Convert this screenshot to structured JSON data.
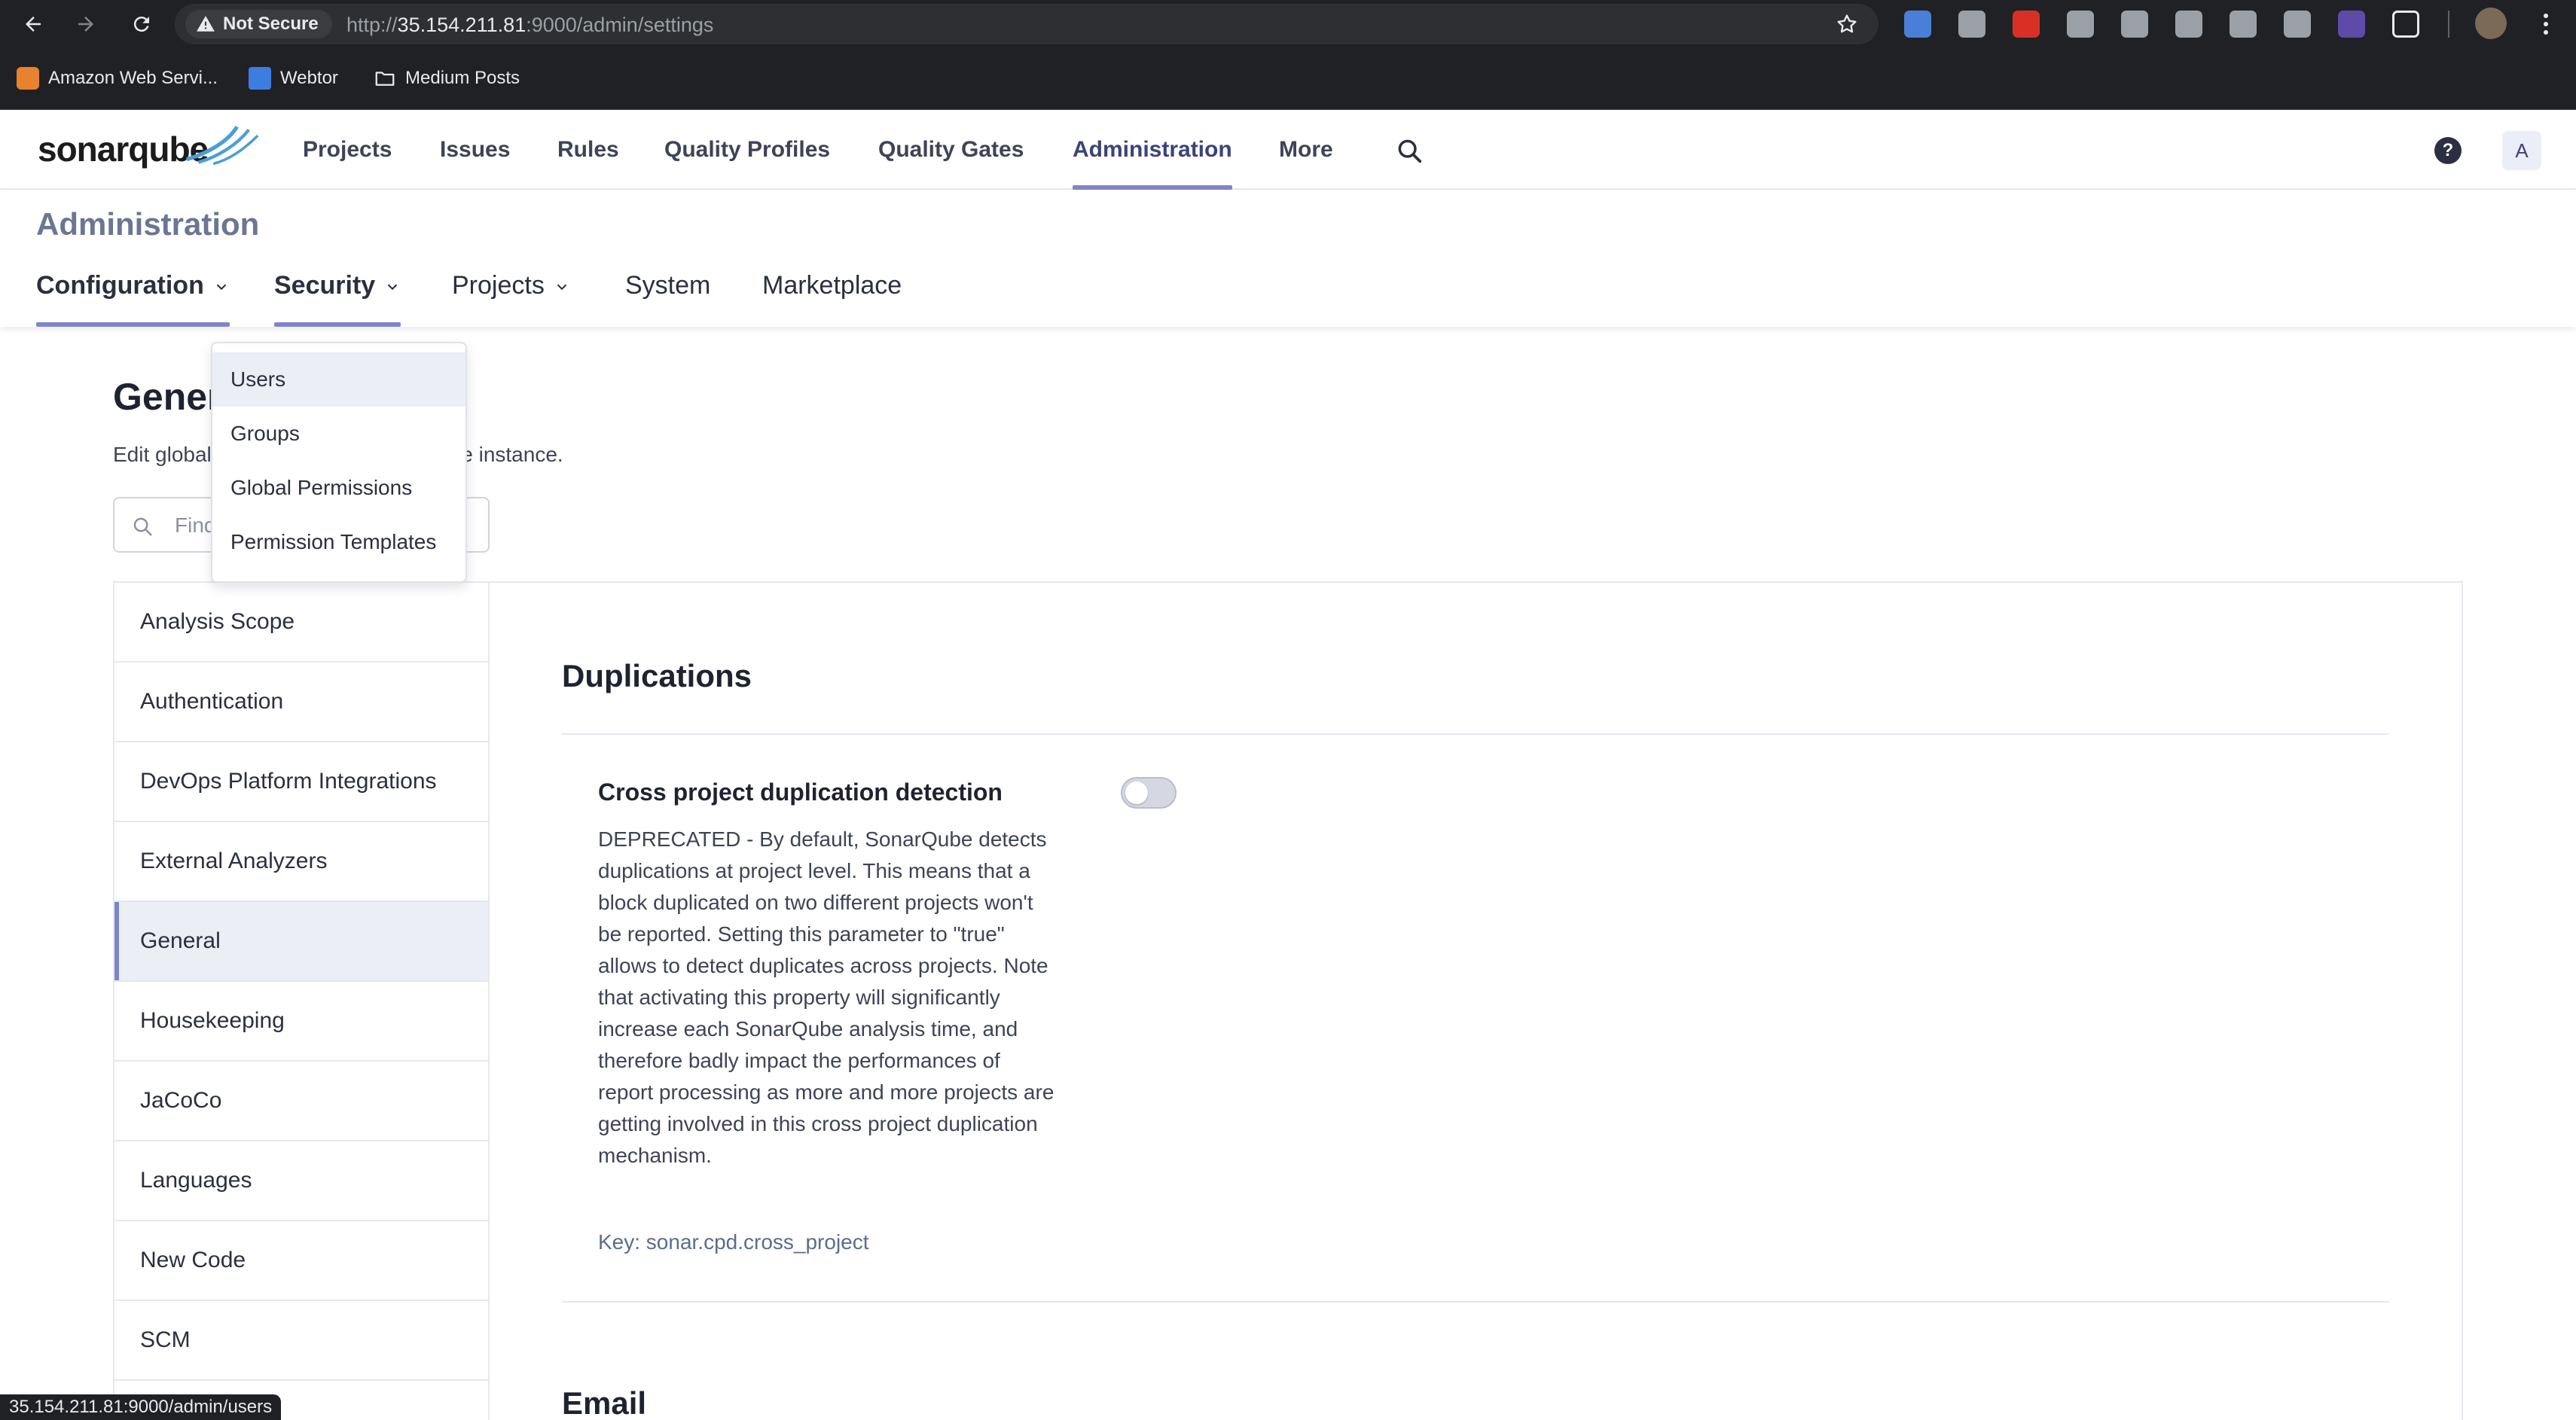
{
  "browser": {
    "security_label": "Not Secure",
    "url_prefix": "http://",
    "url_host": "35.154.211.81",
    "url_rest": ":9000/admin/settings",
    "bookmarks": [
      {
        "label": "Amazon Web Servi..."
      },
      {
        "label": "Webtor"
      },
      {
        "label": "Medium Posts"
      }
    ],
    "extension_colors": [
      "#4a7fd8",
      "#9aa0a6",
      "#d93025",
      "#9aa0a6",
      "#9aa0a6",
      "#9aa0a6",
      "#9aa0a6",
      "#9aa0a6",
      "#5e4aa8"
    ],
    "status_url": "35.154.211.81:9000/admin/users"
  },
  "navbar": {
    "logo": "sonarqube",
    "items": [
      {
        "label": "Projects"
      },
      {
        "label": "Issues"
      },
      {
        "label": "Rules"
      },
      {
        "label": "Quality Profiles"
      },
      {
        "label": "Quality Gates"
      },
      {
        "label": "Administration",
        "active": true
      },
      {
        "label": "More"
      }
    ],
    "help_glyph": "?",
    "avatar_letter": "A"
  },
  "admin": {
    "title": "Administration",
    "tabs": [
      {
        "label": "Configuration",
        "has_menu": true
      },
      {
        "label": "Security",
        "has_menu": true
      },
      {
        "label": "Projects",
        "has_menu": true
      },
      {
        "label": "System"
      },
      {
        "label": "Marketplace"
      }
    ]
  },
  "security_menu": {
    "items": [
      {
        "label": "Users"
      },
      {
        "label": "Groups"
      },
      {
        "label": "Global Permissions"
      },
      {
        "label": "Permission Templates"
      }
    ]
  },
  "page": {
    "title": "General Settings",
    "description": "Edit global settings for this SonarQube instance.",
    "search_placeholder": "Find in Settings..."
  },
  "categories": [
    {
      "label": "Analysis Scope"
    },
    {
      "label": "Authentication"
    },
    {
      "label": "DevOps Platform Integrations"
    },
    {
      "label": "External Analyzers"
    },
    {
      "label": "General",
      "selected": true
    },
    {
      "label": "Housekeeping"
    },
    {
      "label": "JaCoCo"
    },
    {
      "label": "Languages"
    },
    {
      "label": "New Code"
    },
    {
      "label": "SCM"
    }
  ],
  "settings": {
    "section1_title": "Duplications",
    "setting_name": "Cross project duplication detection",
    "setting_description": "DEPRECATED - By default, SonarQube detects duplications at project level. This means that a block duplicated on two different projects won't be reported. Setting this parameter to \"true\" allows to detect duplicates across projects. Note that activating this property will significantly increase each SonarQube analysis time, and therefore badly impact the performances of report processing as more and more projects are getting involved in this cross project duplication mechanism.",
    "setting_key": "Key: sonar.cpd.cross_project",
    "toggle_on": false,
    "section2_title": "Email"
  },
  "colors": {
    "accent": "#7f86c9",
    "chrome_bg": "#202124",
    "nav_text": "#3e4357"
  }
}
